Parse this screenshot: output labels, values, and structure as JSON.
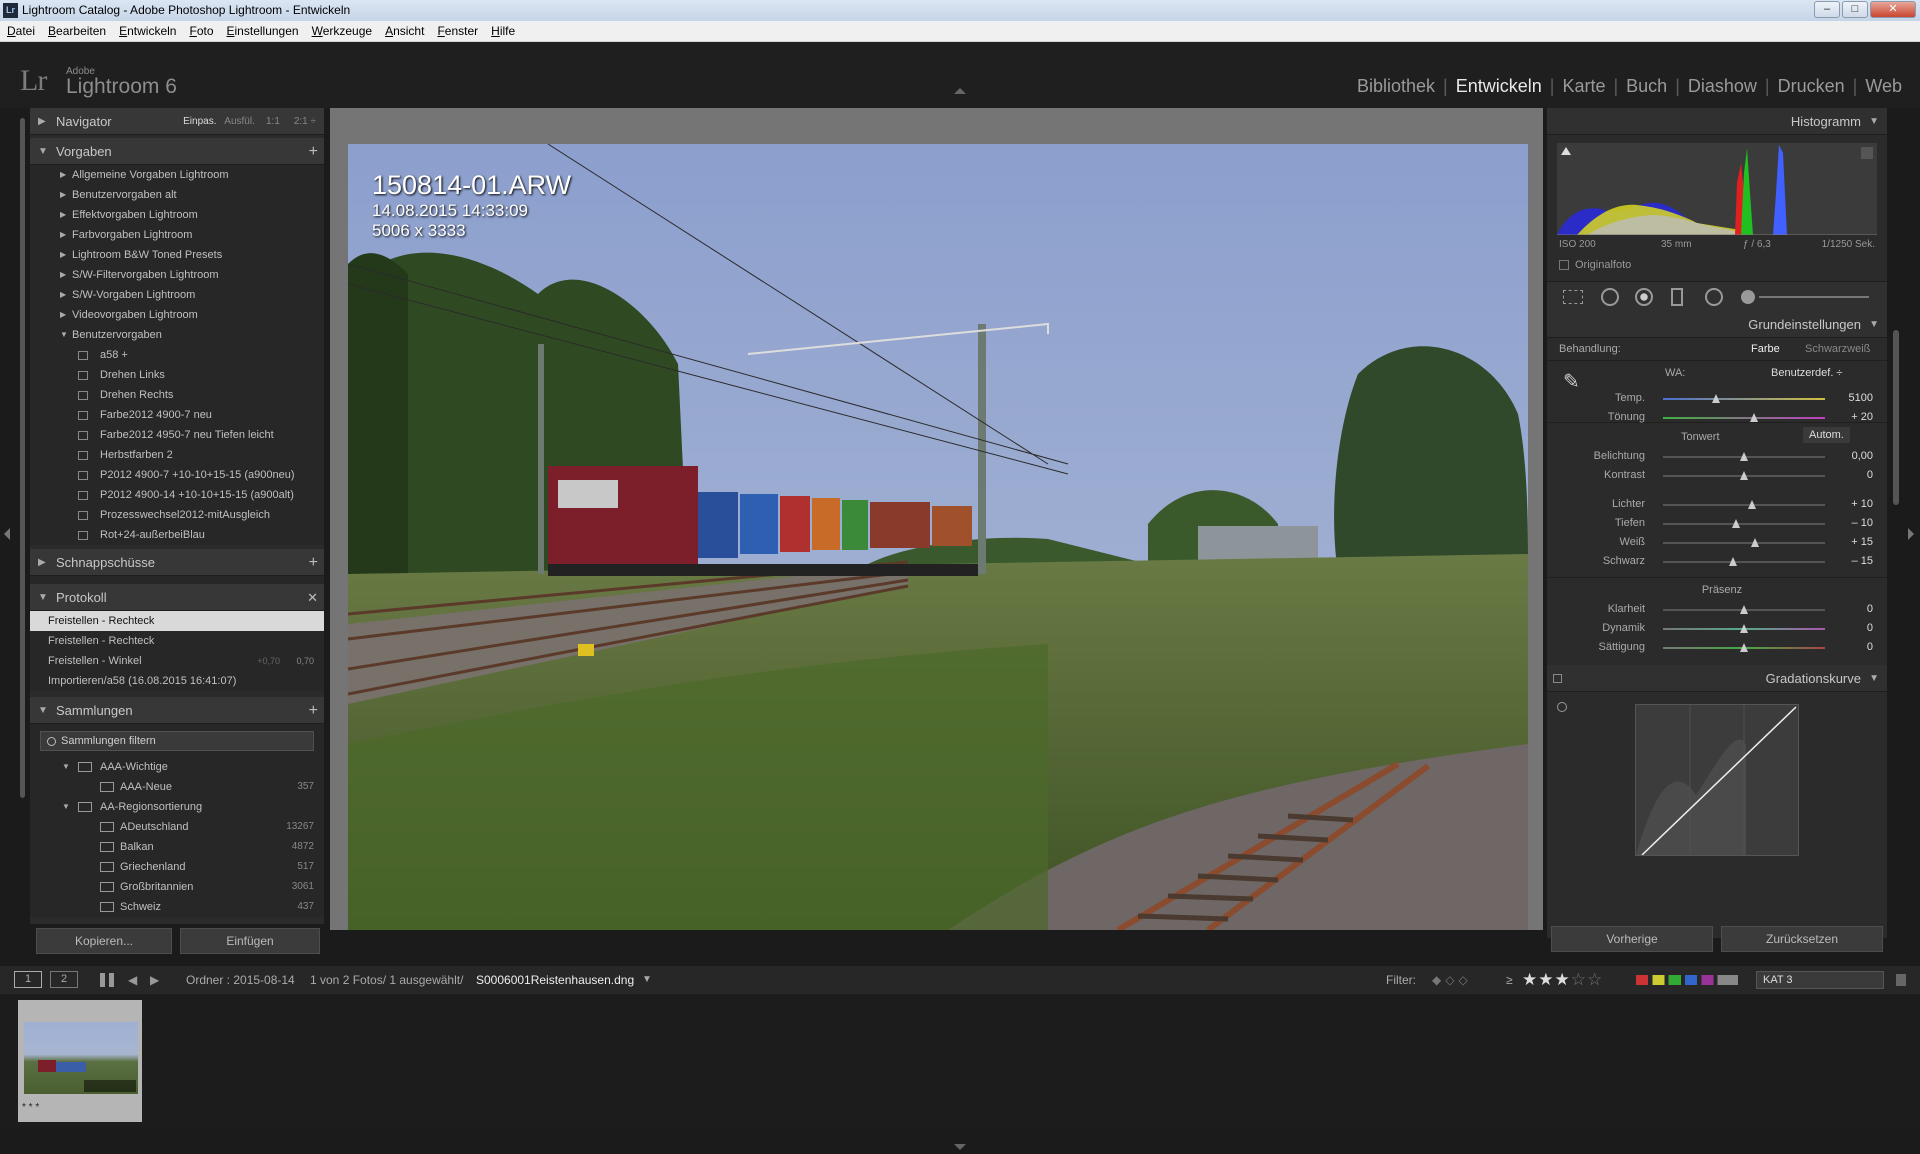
{
  "window": {
    "title": "Lightroom Catalog - Adobe Photoshop Lightroom - Entwickeln",
    "app_icon": "Lr"
  },
  "menu": [
    "Datei",
    "Bearbeiten",
    "Entwickeln",
    "Foto",
    "Einstellungen",
    "Werkzeuge",
    "Ansicht",
    "Fenster",
    "Hilfe"
  ],
  "logo": {
    "mark": "Lr",
    "vendor": "Adobe",
    "product": "Lightroom 6"
  },
  "modules": [
    {
      "label": "Bibliothek"
    },
    {
      "label": "Entwickeln",
      "active": true
    },
    {
      "label": "Karte"
    },
    {
      "label": "Buch"
    },
    {
      "label": "Diashow"
    },
    {
      "label": "Drucken"
    },
    {
      "label": "Web"
    }
  ],
  "left": {
    "navigator": {
      "title": "Navigator",
      "options": [
        "Einpas.",
        "Ausfül.",
        "1:1",
        "2:1"
      ]
    },
    "presets": {
      "title": "Vorgaben",
      "folders": [
        "Allgemeine Vorgaben Lightroom",
        "Benutzervorgaben alt",
        "Effektvorgaben Lightroom",
        "Farbvorgaben Lightroom",
        "Lightroom B&W Toned Presets",
        "S/W-Filtervorgaben Lightroom",
        "S/W-Vorgaben Lightroom",
        "Videovorgaben Lightroom"
      ],
      "open_folder": "Benutzervorgaben",
      "items": [
        "a58 +",
        "Drehen Links",
        "Drehen Rechts",
        "Farbe2012 4900-7 neu",
        "Farbe2012 4950-7 neu Tiefen leicht",
        "Herbstfarben 2",
        "P2012 4900-7 +10-10+15-15 (a900neu)",
        "P2012 4900-14 +10-10+15-15 (a900alt)",
        "Prozesswechsel2012-mitAusgleich",
        "Rot+24-außerbeiBlau"
      ]
    },
    "snapshots": {
      "title": "Schnappschüsse"
    },
    "history": {
      "title": "Protokoll",
      "items": [
        {
          "label": "Freistellen - Rechteck",
          "selected": true
        },
        {
          "label": "Freistellen - Rechteck"
        },
        {
          "label": "Freistellen - Winkel",
          "v1": "+0,70",
          "v2": "0,70"
        },
        {
          "label": "Importieren/a58 (16.08.2015 16:41:07)"
        }
      ]
    },
    "collections": {
      "title": "Sammlungen",
      "filter": "Sammlungen filtern",
      "items": [
        {
          "label": "AAA-Wichtige",
          "level": 0,
          "set": true
        },
        {
          "label": "AAA-Neue",
          "level": 1,
          "count": "357"
        },
        {
          "label": "AA-Regionsortierung",
          "level": 0,
          "set": true
        },
        {
          "label": "ADeutschland",
          "level": 1,
          "count": "13267"
        },
        {
          "label": "Balkan",
          "level": 1,
          "count": "4872"
        },
        {
          "label": "Griechenland",
          "level": 1,
          "count": "517"
        },
        {
          "label": "Großbritannien",
          "level": 1,
          "count": "3061"
        },
        {
          "label": "Schweiz",
          "level": 1,
          "count": "437"
        }
      ]
    },
    "buttons": {
      "copy": "Kopieren...",
      "paste": "Einfügen"
    }
  },
  "photo": {
    "filename": "150814-01.ARW",
    "datetime": "14.08.2015 14:33:09",
    "dimensions": "5006 x 3333"
  },
  "right": {
    "histogram": {
      "title": "Histogramm",
      "iso": "ISO 200",
      "focal": "35 mm",
      "aperture": "ƒ / 6,3",
      "shutter": "1/1250 Sek.",
      "original": "Originalfoto"
    },
    "basic": {
      "title": "Grundeinstellungen",
      "treatment_label": "Behandlung:",
      "color": "Farbe",
      "bw": "Schwarzweiß",
      "wb_label": "WA:",
      "wb_value": "Benutzerdef. ÷",
      "tone_label": "Tonwert",
      "auto": "Autom.",
      "presence_label": "Präsenz",
      "wb": [
        {
          "label": "Temp.",
          "value": "5100",
          "pos": 0.33
        },
        {
          "label": "Tönung",
          "value": "+ 20",
          "pos": 0.56
        }
      ],
      "tone1": [
        {
          "label": "Belichtung",
          "value": "0,00",
          "pos": 0.5
        },
        {
          "label": "Kontrast",
          "value": "0",
          "pos": 0.5
        }
      ],
      "tone2": [
        {
          "label": "Lichter",
          "value": "+ 10",
          "pos": 0.55
        },
        {
          "label": "Tiefen",
          "value": "– 10",
          "pos": 0.45
        },
        {
          "label": "Weiß",
          "value": "+ 15",
          "pos": 0.57
        },
        {
          "label": "Schwarz",
          "value": "– 15",
          "pos": 0.43
        }
      ],
      "presence": [
        {
          "label": "Klarheit",
          "value": "0",
          "pos": 0.5
        },
        {
          "label": "Dynamik",
          "value": "0",
          "pos": 0.5
        },
        {
          "label": "Sättigung",
          "value": "0",
          "pos": 0.5
        }
      ]
    },
    "curve": {
      "title": "Gradationskurve"
    },
    "buttons": {
      "prev": "Vorherige",
      "reset": "Zurücksetzen"
    }
  },
  "filmbar": {
    "screen1": "1",
    "screen2": "2",
    "path": "Ordner : 2015-08-14",
    "count": "1 von 2 Fotos/ 1 ausgewählt/",
    "file": "S0006001Reistenhausen.dng",
    "filter_label": "Filter:",
    "rating_op": "≥",
    "stars": 3,
    "collection": "KAT 3"
  },
  "thumb": {
    "stars": "* * *"
  }
}
